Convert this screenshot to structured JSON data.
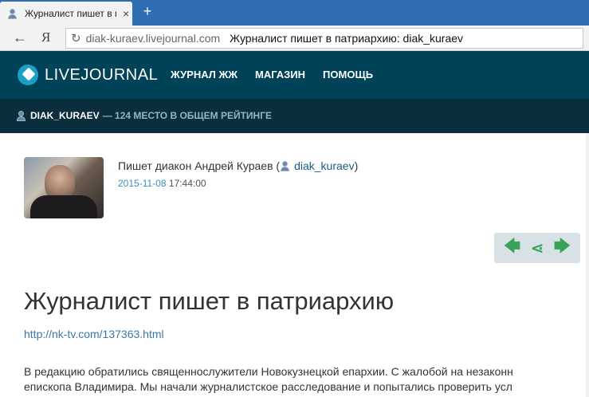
{
  "browser": {
    "tab_title": "Журналист пишет в п",
    "tab_close": "×",
    "new_tab": "+",
    "back": "←",
    "yandex": "Я",
    "reload": "↻",
    "url": "diak-kuraev.livejournal.com",
    "page_title": "Журналист пишет в патриархию: diak_kuraev"
  },
  "lj": {
    "logo": "LIVEJOURNAL",
    "nav": [
      "ЖУРНАЛ ЖЖ",
      "МАГАЗИН",
      "ПОМОЩЬ"
    ],
    "user": "DIAK_KURAEV",
    "rating": "— 124 МЕСТО В ОБЩЕМ РЕЙТИНГЕ"
  },
  "post": {
    "author_prefix": "Пишет диакон Андрей Кураев (",
    "author_user": "diak_kuraev",
    "author_suffix": ")",
    "date": "2015-11-08",
    "time": "17:44:00",
    "share": {
      "prev": "🡄",
      "share": "⋖",
      "next": "🡆"
    },
    "title": "Журналист пишет в патриархию",
    "link": "http://nk-tv.com/137363.html",
    "text_line1": "В редакцию обратились священнослужители Новокузнецкой епархии. С жалобой на незаконн",
    "text_line2": "епископа Владимира. Мы начали журналистское расследование и попытались проверить усл"
  }
}
